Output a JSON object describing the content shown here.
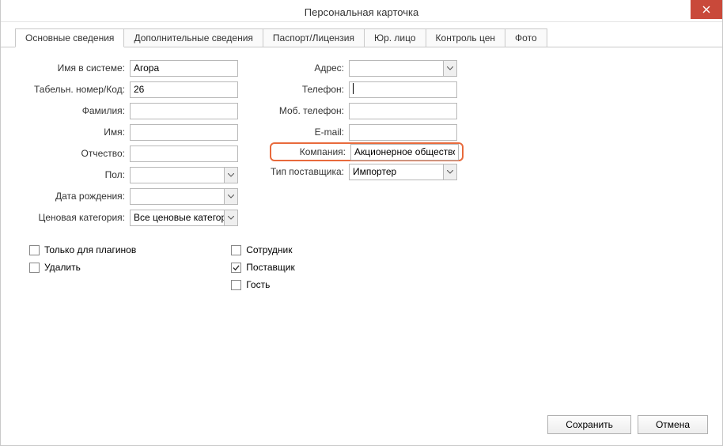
{
  "window": {
    "title": "Персональная карточка"
  },
  "tabs": [
    {
      "label": "Основные сведения",
      "active": true
    },
    {
      "label": "Дополнительные сведения"
    },
    {
      "label": "Паспорт/Лицензия"
    },
    {
      "label": "Юр. лицо"
    },
    {
      "label": "Контроль цен"
    },
    {
      "label": "Фото"
    }
  ],
  "left_fields": {
    "system_name": {
      "label": "Имя в системе:",
      "value": "Агора"
    },
    "tab_number": {
      "label": "Табельн. номер/Код:",
      "value": "26"
    },
    "surname": {
      "label": "Фамилия:",
      "value": ""
    },
    "name": {
      "label": "Имя:",
      "value": ""
    },
    "patronymic": {
      "label": "Отчество:",
      "value": ""
    },
    "gender": {
      "label": "Пол:",
      "value": ""
    },
    "birth_date": {
      "label": "Дата рождения:",
      "value": ""
    },
    "price_cat": {
      "label": "Ценовая категория:",
      "value": "Все ценовые категории"
    }
  },
  "right_fields": {
    "address": {
      "label": "Адрес:",
      "value": ""
    },
    "phone": {
      "label": "Телефон:",
      "value": ""
    },
    "mobile": {
      "label": "Моб. телефон:",
      "value": ""
    },
    "email": {
      "label": "E-mail:",
      "value": ""
    },
    "company": {
      "label": "Компания:",
      "value": "Акционерное общество «А"
    },
    "supplier_type": {
      "label": "Тип поставщика:",
      "value": "Импортер"
    }
  },
  "checks_left": {
    "plugins_only": {
      "label": "Только для плагинов",
      "checked": false
    },
    "delete": {
      "label": "Удалить",
      "checked": false
    }
  },
  "checks_right": {
    "employee": {
      "label": "Сотрудник",
      "checked": false
    },
    "supplier": {
      "label": "Поставщик",
      "checked": true
    },
    "guest": {
      "label": "Гость",
      "checked": false
    }
  },
  "footer": {
    "save": "Сохранить",
    "cancel": "Отмена"
  }
}
